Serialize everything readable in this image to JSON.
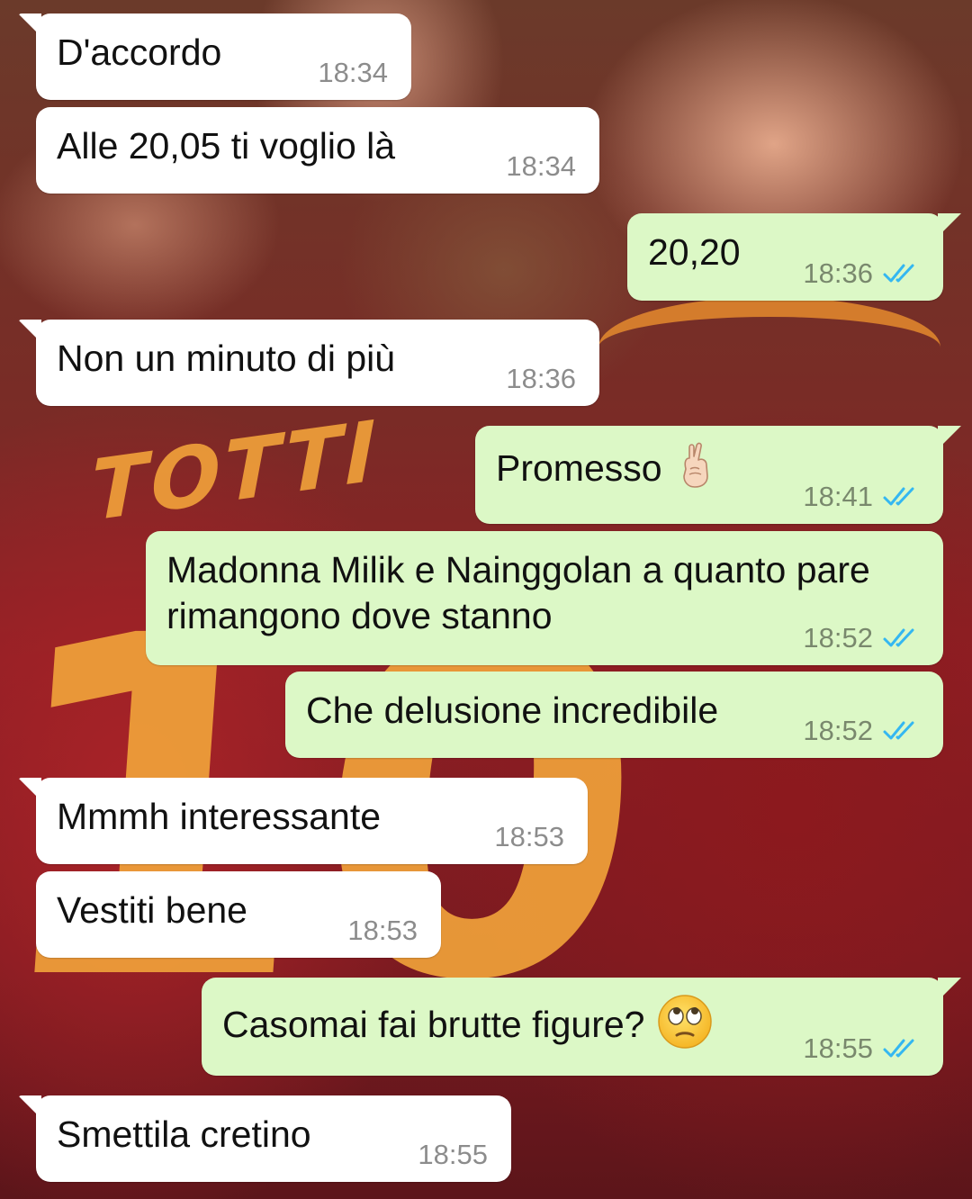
{
  "colors": {
    "incoming_bubble": "#ffffff",
    "outgoing_bubble": "#dcf8c6",
    "read_ticks": "#34b7f1",
    "timestamp": "#8a8a8a"
  },
  "wallpaper": {
    "jersey_name": "TOTTI",
    "jersey_number": "10"
  },
  "messages": [
    {
      "direction": "incoming",
      "text": "D'accordo",
      "time": "18:34"
    },
    {
      "direction": "incoming",
      "text": "Alle 20,05 ti voglio là",
      "time": "18:34"
    },
    {
      "direction": "outgoing",
      "text": "20,20",
      "time": "18:36",
      "status": "read"
    },
    {
      "direction": "incoming",
      "text": "Non un minuto di più",
      "time": "18:36"
    },
    {
      "direction": "outgoing",
      "text": "Promesso",
      "emoji": "crossed-fingers-icon",
      "time": "18:41",
      "status": "read"
    },
    {
      "direction": "outgoing",
      "text": "Madonna Milik e Nainggolan a quanto pare rimangono dove stanno",
      "time": "18:52",
      "status": "read"
    },
    {
      "direction": "outgoing",
      "text": "Che delusione incredibile",
      "time": "18:52",
      "status": "read"
    },
    {
      "direction": "incoming",
      "text": "Mmmh interessante",
      "time": "18:53"
    },
    {
      "direction": "incoming",
      "text": "Vestiti bene",
      "time": "18:53"
    },
    {
      "direction": "outgoing",
      "text": "Casomai fai brutte figure?",
      "emoji": "eye-roll-face-icon",
      "time": "18:55",
      "status": "read"
    },
    {
      "direction": "incoming",
      "text": "Smettila cretino",
      "time": "18:55"
    }
  ]
}
